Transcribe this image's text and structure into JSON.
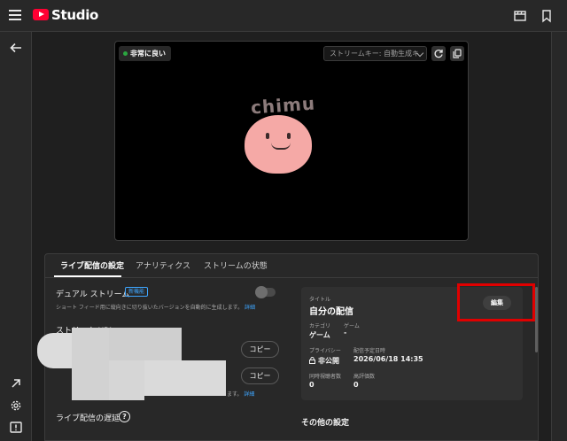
{
  "header": {
    "brand": "Studio"
  },
  "preview": {
    "quality_badge": "非常に良い",
    "stream_key_select": "ストリームキー: 自動生成キ",
    "logo_text": "chimu"
  },
  "tabs": [
    {
      "label": "ライブ配信の設定"
    },
    {
      "label": "アナリティクス"
    },
    {
      "label": "ストリームの状態"
    }
  ],
  "settings": {
    "dual_stream_label": "デュアル ストリーム",
    "new_badge": "新機能",
    "dual_stream_desc": "ショート フィード用に縦向きに切り抜いたバージョンを自動的に生成します。",
    "details_link": "詳細",
    "stream_url_label": "ストリーム URL",
    "copy_label": "コピー",
    "key_desc_suffix": "ます。",
    "delay_label": "ライブ配信の遅延"
  },
  "details": {
    "title_label": "タイトル",
    "title_value": "自分の配信",
    "edit_label": "編集",
    "category_label": "カテゴリ",
    "category_value": "ゲーム",
    "game_label": "ゲーム",
    "game_value": "-",
    "privacy_label": "プライバシー",
    "privacy_value": "非公開",
    "scheduled_label": "配信予定日時",
    "scheduled_value": "2026/06/18 14:35",
    "concurrent_label": "同時視聴者数",
    "concurrent_value": "0",
    "likes_label": "高評価数",
    "likes_value": "0"
  },
  "other_settings_label": "その他の設定",
  "colors": {
    "accent_red": "#ff0033",
    "link_blue": "#3ea6ff",
    "status_green": "#2ba640",
    "highlight_red": "#e00000"
  }
}
